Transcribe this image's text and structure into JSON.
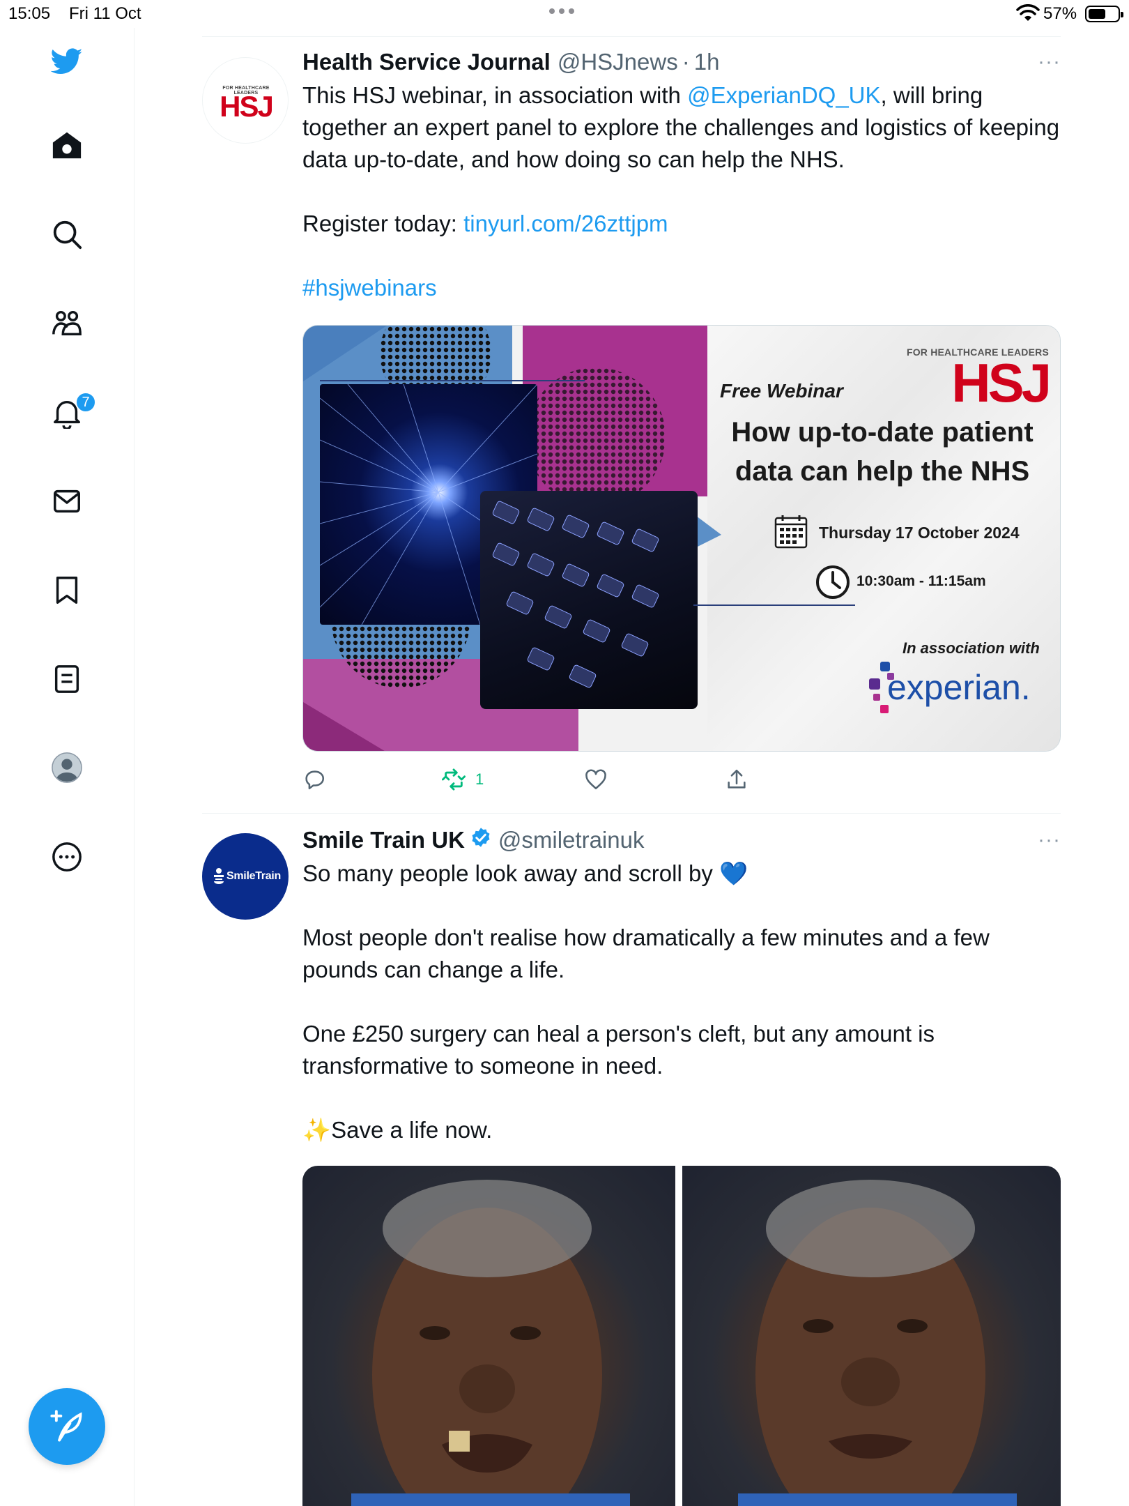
{
  "status_bar": {
    "time": "15:05",
    "date": "Fri 11 Oct",
    "battery_percent": "57%",
    "battery_level": 0.57
  },
  "sidebar": {
    "notifications_badge": "7",
    "items": [
      {
        "name": "twitter-logo-icon"
      },
      {
        "name": "home-icon"
      },
      {
        "name": "search-icon"
      },
      {
        "name": "communities-icon"
      },
      {
        "name": "notifications-icon"
      },
      {
        "name": "messages-icon"
      },
      {
        "name": "bookmarks-icon"
      },
      {
        "name": "lists-icon"
      },
      {
        "name": "profile-icon"
      },
      {
        "name": "more-icon"
      }
    ],
    "compose_icon": "compose-feather-icon"
  },
  "colors": {
    "accent": "#1d9bf0",
    "retweet_green": "#00ba7c",
    "hsj_red": "#d0021b",
    "smiletrain_navy": "#0a2c8c",
    "magenta": "#a8328f",
    "steel_blue": "#5b8fc7"
  },
  "tweets": [
    {
      "name": "Health Service Journal",
      "handle": "@HSJnews",
      "dot": "·",
      "time": "1h",
      "more": "···",
      "avatar_top_text": "FOR HEALTHCARE LEADERS",
      "avatar_logo": "HSJ",
      "text_line1_pre": "This HSJ webinar, in association with ",
      "text_mention": "@ExperianDQ_UK",
      "text_line1_post": ", will bring together an expert panel to explore the challenges and logistics of keeping data up-to-date, and how doing so can help the NHS.",
      "register_label": "Register today: ",
      "register_link": "tinyurl.com/26zttjpm",
      "hashtag": "#hsjwebinars",
      "card": {
        "brand_top": "FOR HEALTHCARE LEADERS",
        "brand_logo": "HSJ",
        "free_webinar": "Free Webinar",
        "headline_1": "How up-to-date patient",
        "headline_2": "data can help the NHS",
        "date": "Thursday 17 October 2024",
        "time": "10:30am - 11:15am",
        "assoc": "In association with",
        "partner": "experian."
      },
      "actions": {
        "retweets": "1"
      }
    },
    {
      "name": "Smile Train UK",
      "handle": "@smiletrainuk",
      "more": "···",
      "avatar_text": "SmileTrain",
      "para1": "So many people look away and scroll by 💙",
      "para2": "Most people don't realise how dramatically a few minutes and a few pounds can change a life.",
      "para3": "One £250 surgery can heal a person's cleft, but any amount is transformative to someone in need.",
      "para4": "✨Save a life now."
    }
  ]
}
